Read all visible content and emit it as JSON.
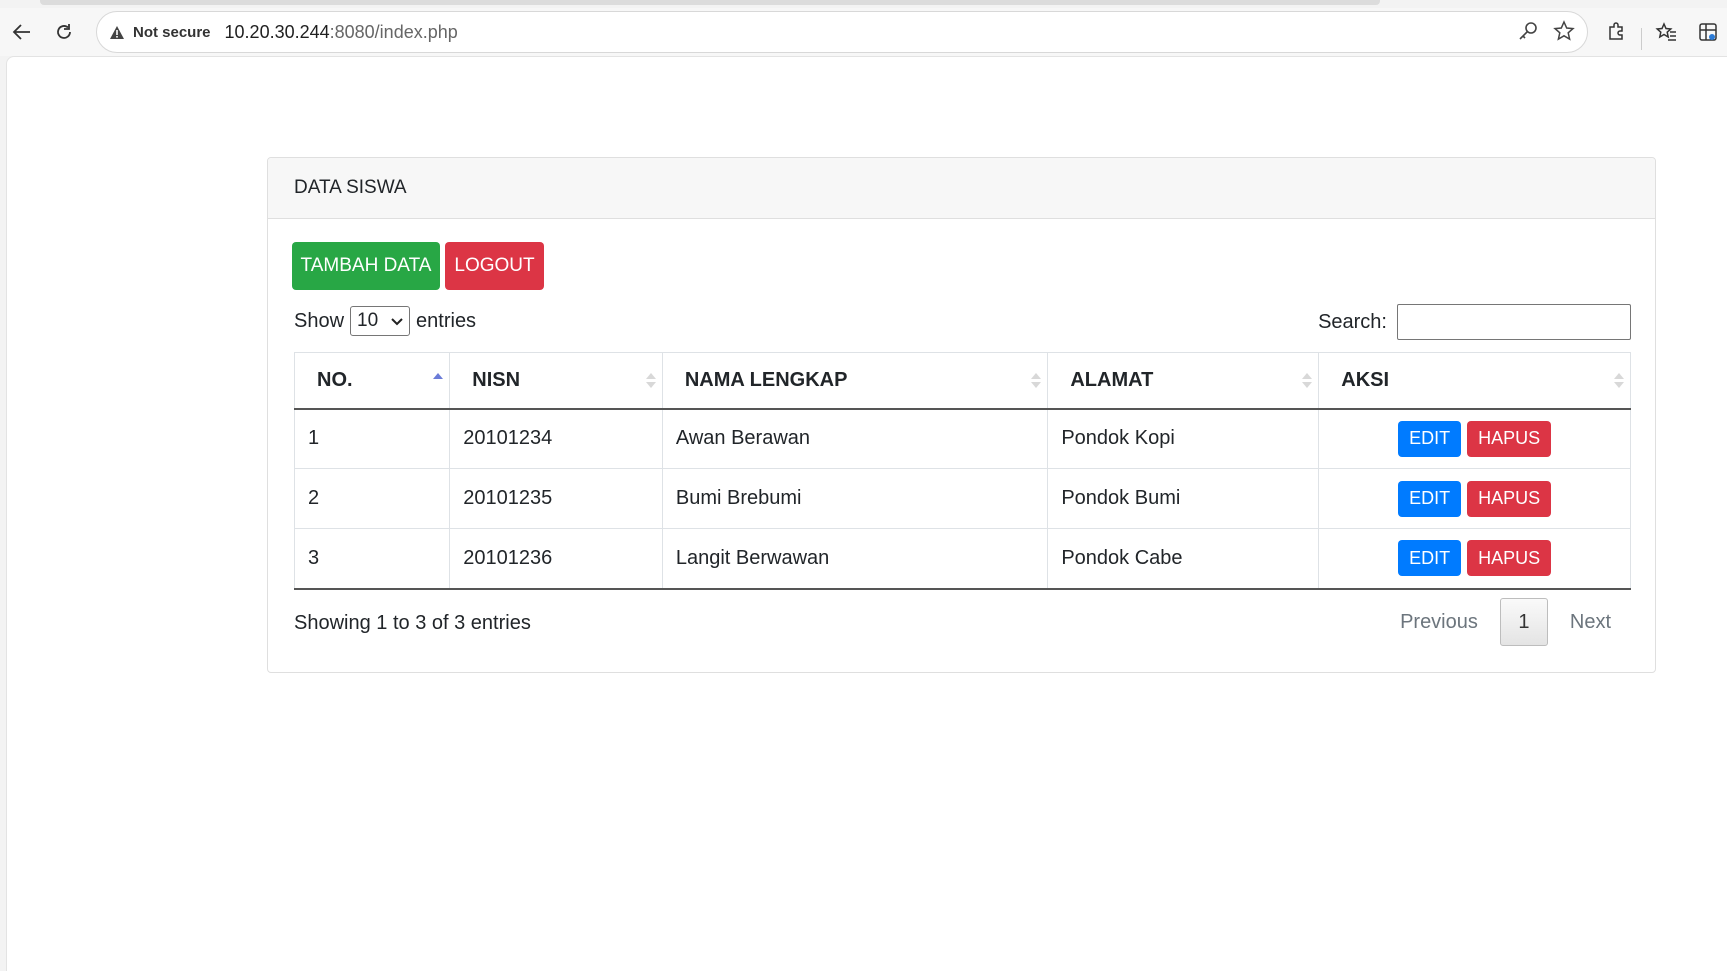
{
  "browser": {
    "security_label": "Not secure",
    "url_host": "10.20.30.244",
    "url_rest": ":8080/index.php",
    "icons": [
      "back-arrow-icon",
      "reload-icon",
      "warning-icon",
      "key-icon",
      "star-icon",
      "extensions-icon",
      "favorites-icon",
      "collections-icon"
    ]
  },
  "card": {
    "title": "DATA SISWA",
    "add_button": "TAMBAH DATA",
    "logout_button": "LOGOUT"
  },
  "table_controls": {
    "show_label": "Show",
    "entries_value": "10",
    "entries_label": "entries",
    "search_label": "Search:",
    "search_value": ""
  },
  "table": {
    "headers": [
      "NO.",
      "NISN",
      "NAMA LENGKAP",
      "ALAMAT",
      "AKSI"
    ],
    "rows": [
      {
        "no": "1",
        "nisn": "20101234",
        "nama": "Awan Berawan",
        "alamat": "Pondok Kopi"
      },
      {
        "no": "2",
        "nisn": "20101235",
        "nama": "Bumi Brebumi",
        "alamat": "Pondok Bumi"
      },
      {
        "no": "3",
        "nisn": "20101236",
        "nama": "Langit Berwawan",
        "alamat": "Pondok Cabe"
      }
    ],
    "edit_label": "EDIT",
    "delete_label": "HAPUS"
  },
  "footer": {
    "info": "Showing 1 to 3 of 3 entries",
    "previous": "Previous",
    "current_page": "1",
    "next": "Next"
  },
  "colors": {
    "success": "#28a745",
    "danger": "#dc3545",
    "primary": "#007bff"
  }
}
